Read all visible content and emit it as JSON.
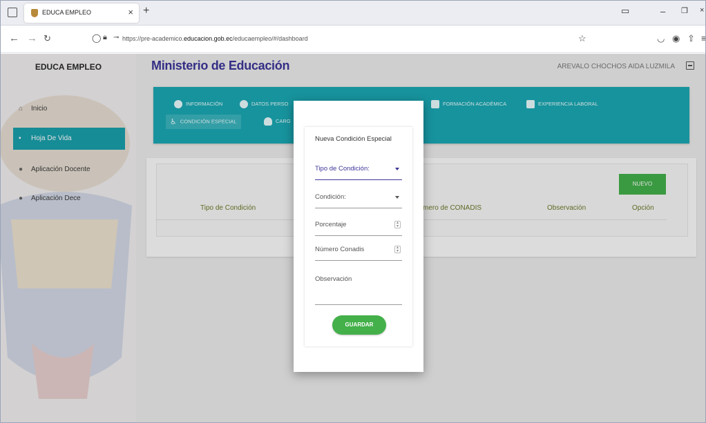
{
  "browser": {
    "tab_title": "EDUCA EMPLEO",
    "url_prefix": "https://pre-academico.",
    "url_domain": "educacion.gob.ec",
    "url_suffix": "/educaempleo/#/dashboard"
  },
  "sidebar": {
    "app_title": "EDUCA EMPLEO",
    "items": [
      {
        "label": "Inicio",
        "icon": "home-icon",
        "active": false
      },
      {
        "label": "Hoja De Vida",
        "icon": "document-icon",
        "active": true
      },
      {
        "label": "Aplicación Docente",
        "icon": "person-icon",
        "active": false
      },
      {
        "label": "Aplicación Dece",
        "icon": "person-icon",
        "active": false
      }
    ]
  },
  "header": {
    "ministry": "Ministerio de Educación",
    "user": "AREVALO CHOCHOS AIDA LUZMILA"
  },
  "tabs": [
    {
      "label": "INFORMACIÓN",
      "icon": "info-icon"
    },
    {
      "label": "DATOS PERSO",
      "icon": "person-circle-icon"
    },
    {
      "label": "FORMACIÓN ACADÉMICA",
      "icon": "puzzle-icon"
    },
    {
      "label": "EXPERIENCIA LABORAL",
      "icon": "briefcase-icon"
    },
    {
      "label": "CONDICIÓN ESPECIAL",
      "icon": "accessibility-icon"
    },
    {
      "label": "CARG",
      "icon": "cloud-upload-icon"
    }
  ],
  "table": {
    "new_button": "NUEVO",
    "headers": [
      "Tipo de Condición",
      "mero de CONADIS",
      "Observación",
      "Opción"
    ]
  },
  "modal": {
    "title": "Nueva Condición Especial",
    "fields": {
      "tipo": "Tipo de Condición:",
      "condicion": "Condición:",
      "porcentaje": "Porcentaje",
      "conadis": "Número Conadis",
      "observacion": "Observación"
    },
    "save_button": "GUARDAR"
  },
  "colors": {
    "teal": "#1ba8b3",
    "primary": "#3c3598",
    "green": "#43b04a"
  }
}
